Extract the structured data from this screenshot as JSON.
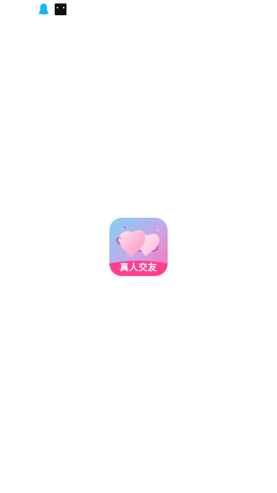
{
  "status_bar": {
    "icons": [
      {
        "name": "qq-penguin-icon",
        "color": "#12B7F5"
      },
      {
        "name": "terminal-icon",
        "color": "#111111"
      }
    ]
  },
  "splash": {
    "app_icon": {
      "name": "hearts-logo-icon",
      "label": "真人交友",
      "colors": {
        "gradient_top": "#7FD3F7",
        "gradient_bottom": "#FF6FB1",
        "banner": "#FF3E8E",
        "heart": "#FFB3D6"
      }
    }
  }
}
